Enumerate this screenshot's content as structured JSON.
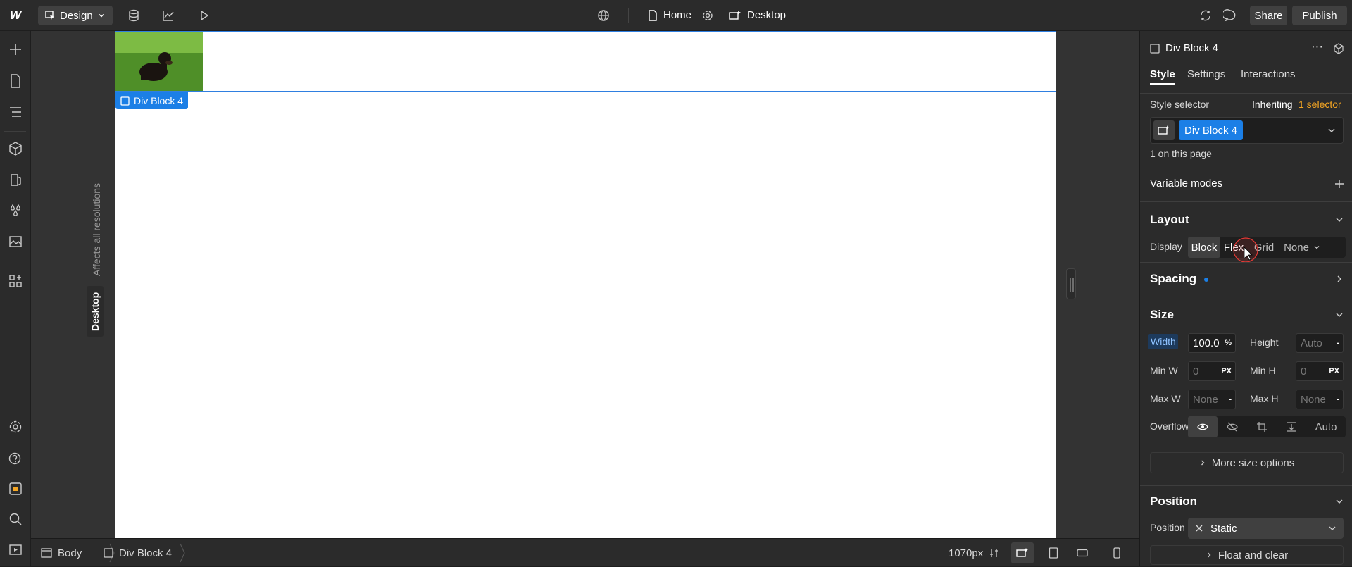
{
  "topbar": {
    "logo": "W",
    "mode": "Design",
    "page_name": "Home",
    "breakpoint": "Desktop",
    "share_label": "Share",
    "publish_label": "Publish"
  },
  "canvas": {
    "affects_label": "Affects all resolutions",
    "breakpoint_tab": "Desktop",
    "selected_label": "Div Block 4"
  },
  "bottombar": {
    "breadcrumb_body": "Body",
    "breadcrumb_block": "Div Block 4",
    "width_readout": "1070px"
  },
  "panel": {
    "element_name": "Div Block 4",
    "tabs": [
      "Style",
      "Settings",
      "Interactions"
    ],
    "style_selector_label": "Style selector",
    "inheriting_label": "Inheriting",
    "inheriting_count": "1 selector",
    "selector_chip": "Div Block 4",
    "on_page": "1 on this page",
    "variable_modes": "Variable modes",
    "layout": {
      "title": "Layout",
      "display_label": "Display",
      "options": [
        "Block",
        "Flex",
        "Grid",
        "None"
      ]
    },
    "spacing_title": "Spacing",
    "size": {
      "title": "Size",
      "width_label": "Width",
      "width_value": "100.0",
      "width_unit": "%",
      "height_label": "Height",
      "height_value": "Auto",
      "height_unit": "-",
      "minw_label": "Min W",
      "minw_value": "0",
      "minw_unit": "PX",
      "minh_label": "Min H",
      "minh_value": "0",
      "minh_unit": "PX",
      "maxw_label": "Max W",
      "maxw_value": "None",
      "maxw_unit": "-",
      "maxh_label": "Max H",
      "maxh_value": "None",
      "maxh_unit": "-",
      "overflow_label": "Overflow",
      "overflow_auto": "Auto",
      "more_options": "More size options"
    },
    "position": {
      "title": "Position",
      "label": "Position",
      "value": "Static",
      "float_clear": "Float and clear"
    }
  },
  "colors": {
    "accent": "#1b7fe6",
    "orange": "#f5a623"
  }
}
